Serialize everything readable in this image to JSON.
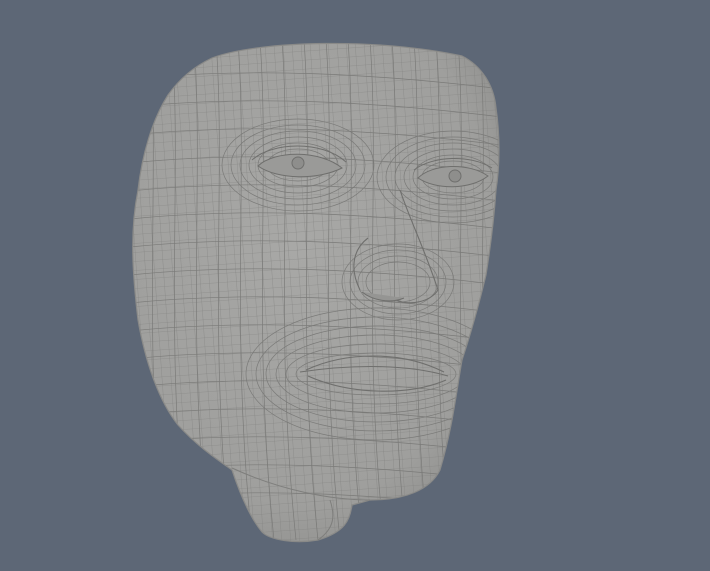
{
  "viewport": {
    "background_color": "#5d6776"
  },
  "model": {
    "type": "head-wireframe-mesh",
    "surface_color": "#a2a2a0",
    "wire_color": "#7e7e7c",
    "shadow_color": "#8f8f8d"
  }
}
